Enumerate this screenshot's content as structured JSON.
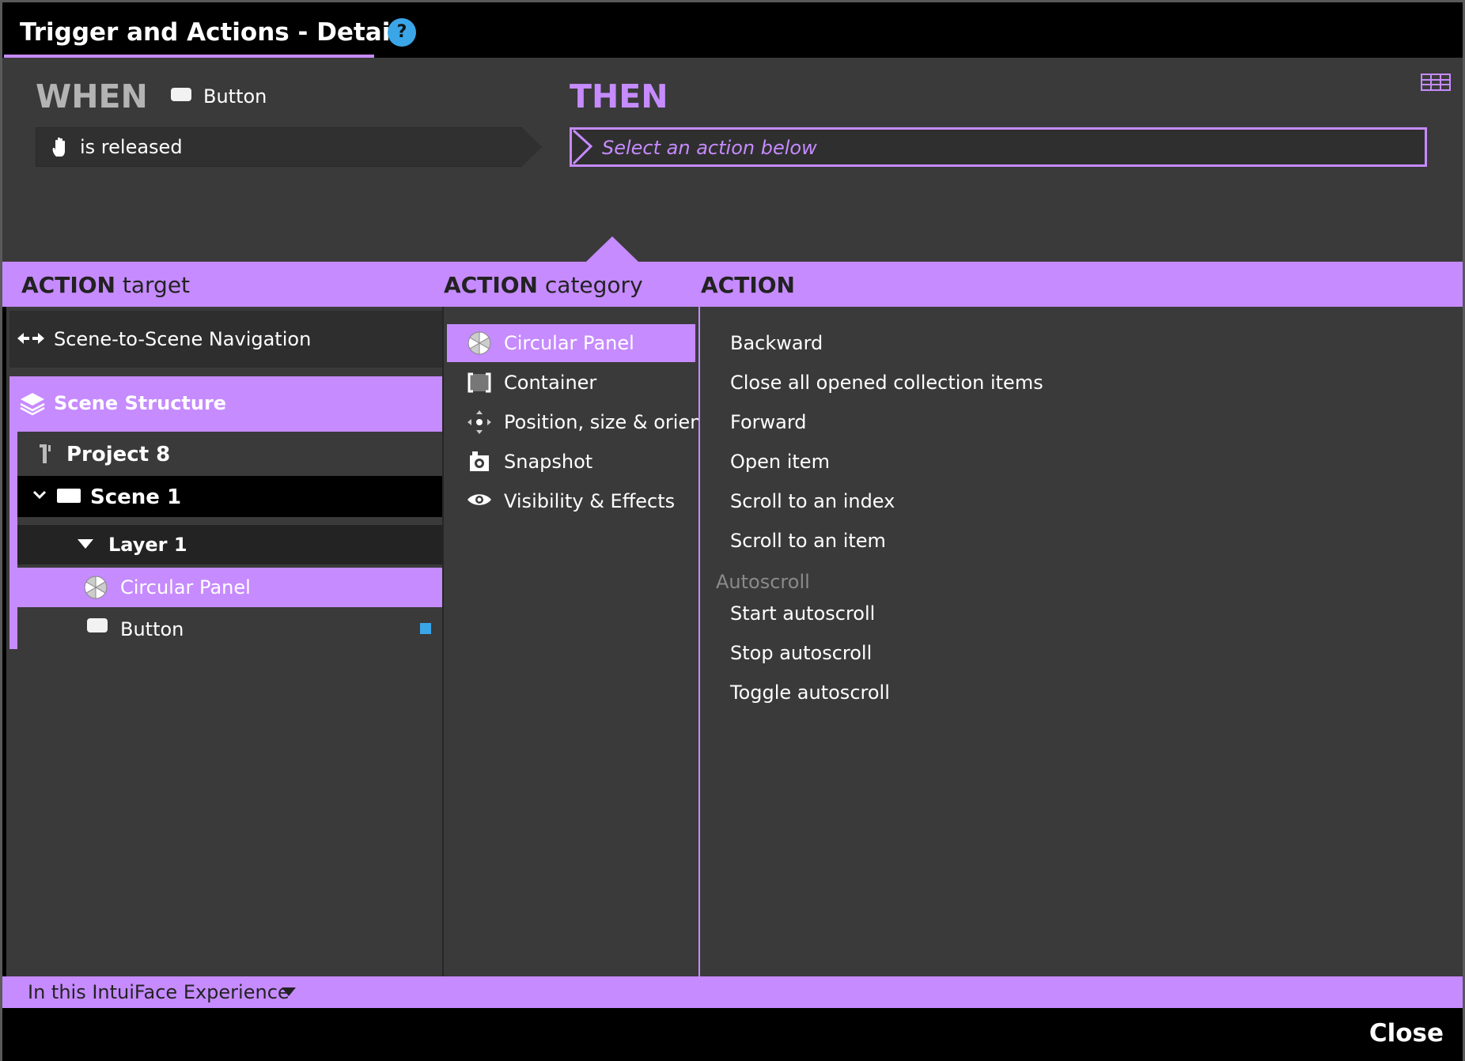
{
  "window": {
    "title": "Trigger and Actions - Details",
    "help_symbol": "?"
  },
  "when": {
    "label": "WHEN",
    "source": "Button",
    "trigger": "is released"
  },
  "then": {
    "label": "THEN",
    "placeholder": "Select an action below"
  },
  "headers": {
    "target_strong": "ACTION",
    "target_light": "target",
    "category_strong": "ACTION",
    "category_light": "category",
    "action": "ACTION"
  },
  "targets": {
    "navigation": "Scene-to-Scene Navigation",
    "scene_structure": "Scene Structure",
    "project": "Project 8",
    "scene": "Scene 1",
    "layer": "Layer 1",
    "selected_item": "Circular Panel",
    "button_item": "Button"
  },
  "categories": [
    {
      "label": "Circular Panel",
      "icon": "circular-panel-icon",
      "selected": true
    },
    {
      "label": "Container",
      "icon": "container-icon",
      "selected": false
    },
    {
      "label": "Position, size & orien...",
      "icon": "move-icon",
      "selected": false
    },
    {
      "label": "Snapshot",
      "icon": "camera-icon",
      "selected": false
    },
    {
      "label": "Visibility & Effects",
      "icon": "eye-icon",
      "selected": false
    }
  ],
  "actions": {
    "items": [
      "Backward",
      "Close all opened collection items",
      "Forward",
      "Open item",
      "Scroll to an index",
      "Scroll to an item"
    ],
    "group_label": "Autoscroll",
    "group_items": [
      "Start autoscroll",
      "Stop autoscroll",
      "Toggle autoscroll"
    ]
  },
  "footer": {
    "scope": "In this IntuiFace Experience",
    "close": "Close"
  },
  "colors": {
    "accent": "#c68bff",
    "panel": "#3a3a3a",
    "help": "#3aa6e8",
    "indicator": "#3aa6e8"
  }
}
